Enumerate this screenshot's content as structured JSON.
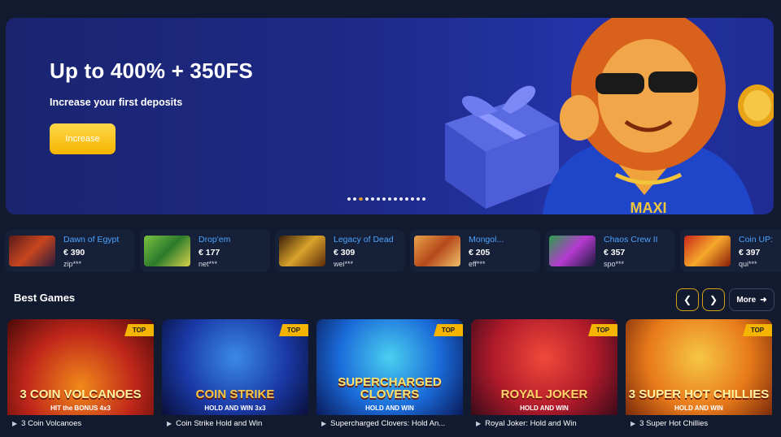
{
  "banner": {
    "title": "Up to 400% + 350FS",
    "subtitle": "Increase your first deposits",
    "button_label": "Increase",
    "mascot_text": "MAXI",
    "slide_count": 14,
    "active_slide": 2
  },
  "winners": [
    {
      "game": "Dawn of Egypt",
      "amount": "€ 390",
      "user": "zip***"
    },
    {
      "game": "Drop'em",
      "amount": "€ 177",
      "user": "net***"
    },
    {
      "game": "Legacy of Dead",
      "amount": "€ 309",
      "user": "wei***"
    },
    {
      "game": "Mongol...",
      "amount": "€ 205",
      "user": "eff***"
    },
    {
      "game": "Chaos Crew II",
      "amount": "€ 357",
      "user": "spo***"
    },
    {
      "game": "Coin UP:",
      "amount": "€ 397",
      "user": "qui***"
    }
  ],
  "best_games": {
    "title": "Best Games",
    "prev_icon": "chevron-left-icon",
    "next_icon": "chevron-right-icon",
    "more_label": "More",
    "items": [
      {
        "name": "3 Coin Volcanoes",
        "badge": "TOP",
        "art_text": "3 COIN VOLCANOES",
        "art_sub": "HIT the BONUS 4x3"
      },
      {
        "name": "Coin Strike Hold and Win",
        "badge": "TOP",
        "art_text": "COIN STRIKE",
        "art_sub": "HOLD AND WIN 3x3"
      },
      {
        "name": "Supercharged Clovers: Hold An...",
        "badge": "TOP",
        "art_text": "SUPERCHARGED CLOVERS",
        "art_sub": "HOLD AND WIN"
      },
      {
        "name": "Royal Joker: Hold and Win",
        "badge": "TOP",
        "art_text": "ROYAL JOKER",
        "art_sub": "HOLD AND WIN"
      },
      {
        "name": "3 Super Hot Chillies",
        "badge": "TOP",
        "art_text": "3 SUPER HOT CHILLIES",
        "art_sub": "HOLD AND WIN"
      }
    ]
  },
  "colors": {
    "accent": "#f4b400",
    "link": "#4aa3ff",
    "background": "#121a2f",
    "card": "#172039"
  }
}
